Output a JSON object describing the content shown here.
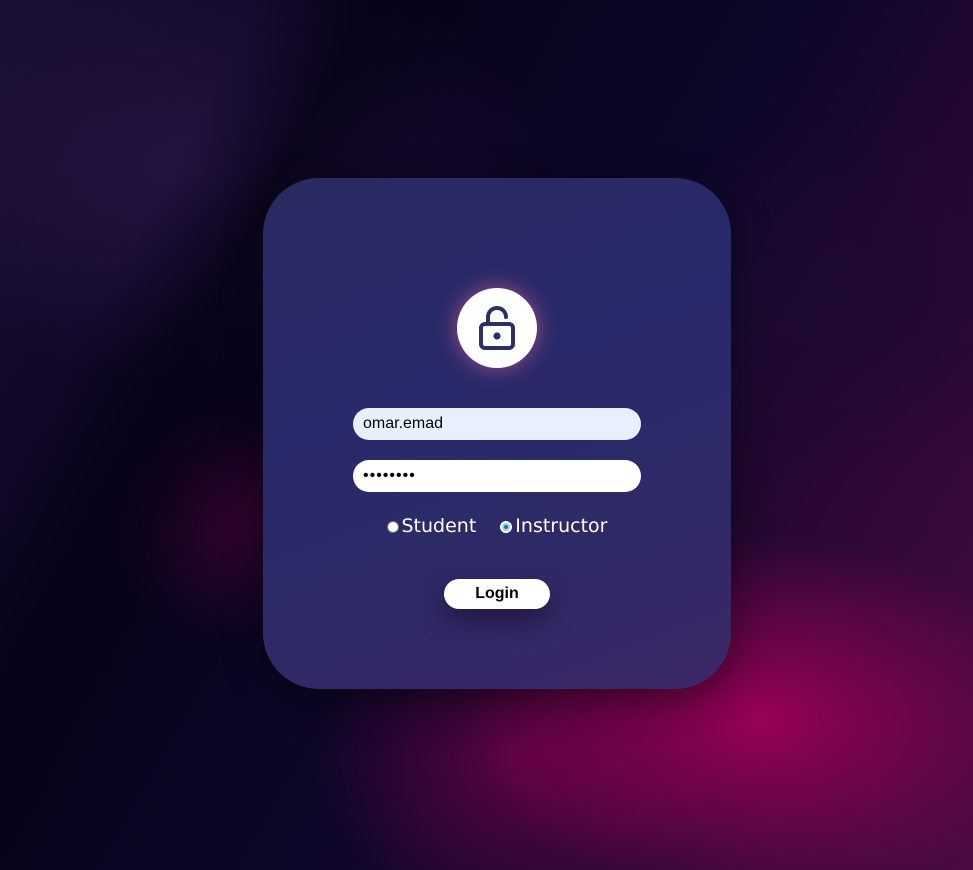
{
  "background": {
    "primary_colors": [
      "#07031a",
      "#2a0833",
      "#aa005a"
    ]
  },
  "login_card": {
    "background_color": "#28296a",
    "lock_icon": "unlock-icon",
    "lock_icon_color": "#2b2f66",
    "username": {
      "value": "omar.emad"
    },
    "password": {
      "value": "••••••••"
    },
    "roles": {
      "options": [
        {
          "label": "Student",
          "selected": false
        },
        {
          "label": "Instructor",
          "selected": true
        }
      ]
    },
    "login_button": {
      "label": "Login"
    }
  }
}
